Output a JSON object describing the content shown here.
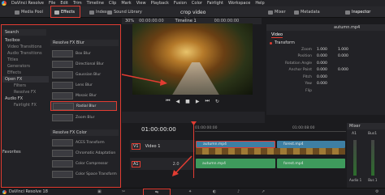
{
  "menu": {
    "items": [
      "DaVinci Resolve",
      "File",
      "Edit",
      "Trim",
      "Timeline",
      "Clip",
      "Mark",
      "View",
      "Playback",
      "Fusion",
      "Color",
      "Fairlight",
      "Workspace",
      "Help"
    ]
  },
  "toolbar": {
    "media_pool": "Media Pool",
    "effects": "Effects",
    "index": "Index",
    "sound_library": "Sound Library",
    "project_title": "crop video",
    "edited": "Edited",
    "mixer": "Mixer",
    "metadata": "Metadata",
    "inspector": "Inspector"
  },
  "viewer_bar": {
    "zoom": "30%",
    "timecode": "00:00:00:00",
    "timeline_name": "Timeline 1",
    "right_timecode": "00:00:00:00"
  },
  "effects_panel": {
    "search": "Search",
    "tree": [
      {
        "label": "Toolbox",
        "level": "head"
      },
      {
        "label": "Video Transitions",
        "level": "item"
      },
      {
        "label": "Audio Transitions",
        "level": "item"
      },
      {
        "label": "Titles",
        "level": "item"
      },
      {
        "label": "Generators",
        "level": "item"
      },
      {
        "label": "Effects",
        "level": "item"
      },
      {
        "label": "Open FX",
        "level": "head"
      },
      {
        "label": "Filters",
        "level": "sub"
      },
      {
        "label": "Resolve FX",
        "level": "sub"
      },
      {
        "label": "Audio FX",
        "level": "head"
      },
      {
        "label": "Fairlight FX",
        "level": "sub"
      }
    ],
    "favorites": "Favorites",
    "blur_group": "Resolve FX Blur",
    "blur_items": [
      "Box Blur",
      "Directional Blur",
      "Gaussian Blur",
      "Lens Blur",
      "Mosaic Blur",
      "Radial Blur",
      "Zoom Blur"
    ],
    "color_group": "Resolve FX Color",
    "color_items": [
      "ACES Transform",
      "Chromatic Adaptation",
      "Color Compressor",
      "Color Space Transform"
    ]
  },
  "inspector": {
    "filename": "autumn.mp4",
    "tab_video": "Video",
    "section_transform": "Transform",
    "rows": [
      {
        "label": "Zoom",
        "x": "1.000",
        "y": "1.000"
      },
      {
        "label": "Position",
        "x": "0.000",
        "y": "0.000"
      },
      {
        "label": "Rotation Angle",
        "x": "0.000",
        "y": ""
      },
      {
        "label": "Anchor Point",
        "x": "0.000",
        "y": "0.000"
      },
      {
        "label": "Pitch",
        "x": "0.000",
        "y": ""
      },
      {
        "label": "Yaw",
        "x": "0.000",
        "y": ""
      },
      {
        "label": "Flip",
        "x": "",
        "y": ""
      }
    ]
  },
  "timeline": {
    "timecode": "01:00:00:00",
    "ruler_labels": [
      "01:00:00:00",
      "01:00:08:00"
    ],
    "v1_label": "V1",
    "video_track": "Video 1",
    "a1_label": "A1",
    "audio_value": "2.0",
    "clips_video": [
      "autumn.mp4",
      "forest.mp4"
    ],
    "clips_audio": [
      "autumn.mp4",
      "forest.mp4"
    ]
  },
  "mixer": {
    "title": "Mixer",
    "channels": [
      "A1",
      "Bus1"
    ],
    "labels": [
      "Audio 1",
      "Bus 1"
    ]
  },
  "status": {
    "app": "DaVinci Resolve 18"
  },
  "colors": {
    "accent_red": "#e23c32",
    "video_clip": "#3e7fa3",
    "audio_clip": "#3e9a5c"
  }
}
